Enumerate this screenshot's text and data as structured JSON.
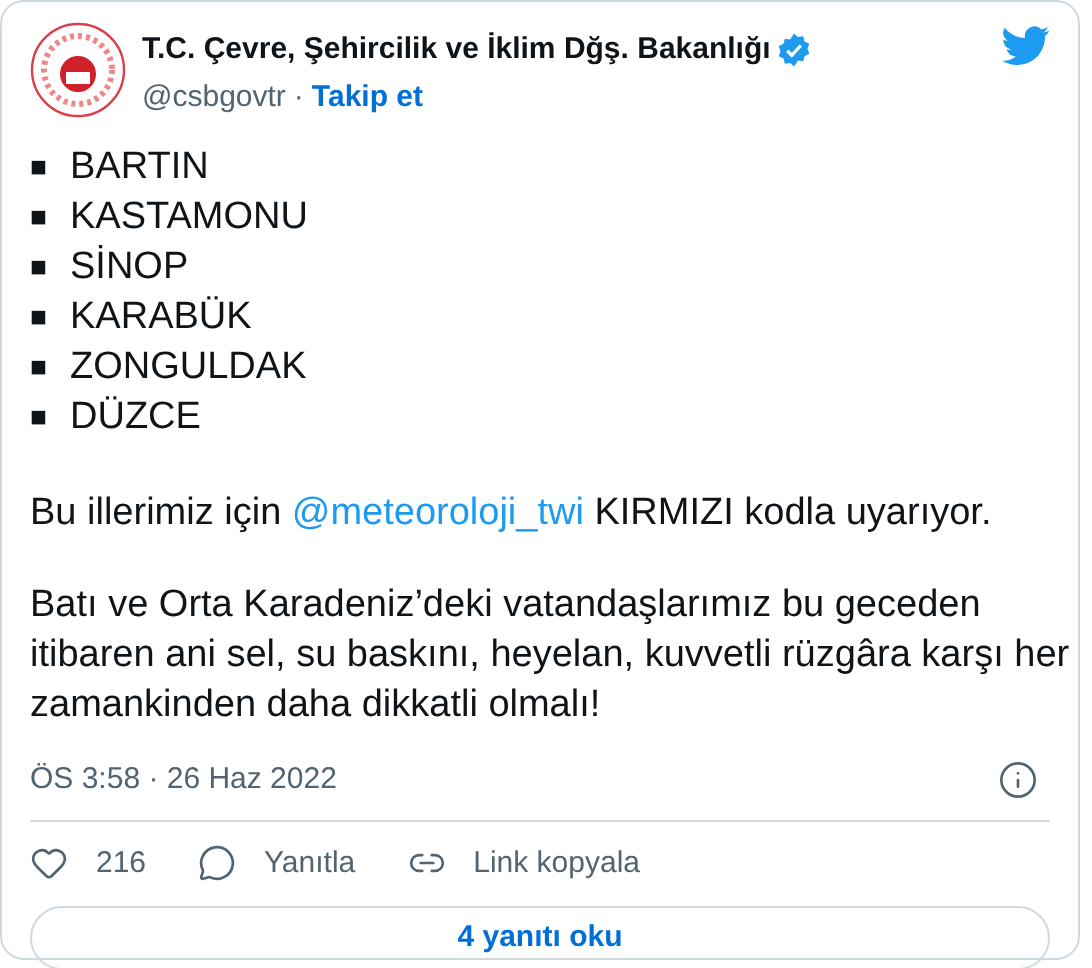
{
  "author": {
    "name": "T.C. Çevre, Şehircilik ve İklim Dğş. Bakanlığı",
    "verified": true,
    "handle": "@csbgovtr",
    "separator": "·",
    "follow": "Takip et"
  },
  "list": [
    {
      "bullet": "■",
      "text": "BARTIN"
    },
    {
      "bullet": "■",
      "text": "KASTAMONU"
    },
    {
      "bullet": "■",
      "text": "SİNOP"
    },
    {
      "bullet": "■",
      "text": "KARABÜK"
    },
    {
      "bullet": "■",
      "text": "ZONGULDAK"
    },
    {
      "bullet": "■",
      "text": "DÜZCE"
    }
  ],
  "sentence": {
    "before": "Bu illerimiz için ",
    "mention": "@meteoroloji_twi",
    "after": " KIRMIZI kodla uyarıyor."
  },
  "paragraph": "Batı ve Orta Karadeniz’deki vatandaşlarımız bu geceden itibaren ani sel, su baskını, heyelan, kuvvetli rüzgâra karşı her zamankinden daha dikkatli olmalı!",
  "timestamp": "ÖS 3:58 · 26 Haz 2022",
  "actions": [
    {
      "kind": "like",
      "label": "216"
    },
    {
      "kind": "reply",
      "label": "Yanıtla"
    },
    {
      "kind": "link",
      "label": "Link kopyala"
    }
  ],
  "read_replies": "4 yanıtı oku"
}
